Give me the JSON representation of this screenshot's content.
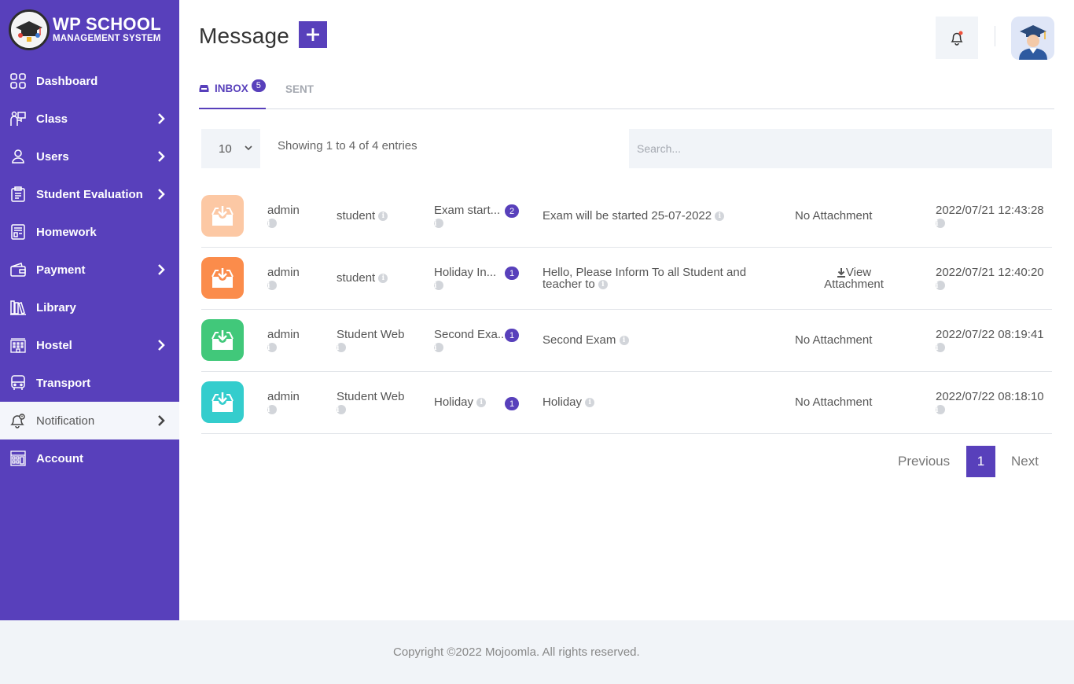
{
  "brand": {
    "title": "WP SCHOOL",
    "subtitle": "MANAGEMENT SYSTEM",
    "color": "#5840bb"
  },
  "sidebar": {
    "items": [
      {
        "label": "Dashboard",
        "icon": "dashboard-icon",
        "has_children": false
      },
      {
        "label": "Class",
        "icon": "class-icon",
        "has_children": true
      },
      {
        "label": "Users",
        "icon": "user-icon",
        "has_children": true
      },
      {
        "label": "Student Evaluation",
        "icon": "clipboard-icon",
        "has_children": true
      },
      {
        "label": "Homework",
        "icon": "homework-icon",
        "has_children": false
      },
      {
        "label": "Payment",
        "icon": "wallet-icon",
        "has_children": true
      },
      {
        "label": "Library",
        "icon": "books-icon",
        "has_children": false
      },
      {
        "label": "Hostel",
        "icon": "building-icon",
        "has_children": true
      },
      {
        "label": "Transport",
        "icon": "bus-icon",
        "has_children": false
      },
      {
        "label": "Notification",
        "icon": "notification-bell-icon",
        "has_children": true,
        "active": true
      },
      {
        "label": "Account",
        "icon": "account-icon",
        "has_children": false
      }
    ]
  },
  "header": {
    "title": "Message",
    "add_icon": "plus-icon",
    "bell_icon": "bell-icon",
    "avatar_icon": "graduate-avatar-icon"
  },
  "tabs": {
    "inbox_label": "INBOX",
    "inbox_count": "5",
    "sent_label": "SENT"
  },
  "table_controls": {
    "page_length": "10",
    "info": "Showing 1 to 4 of 4 entries",
    "search_placeholder": "Search..."
  },
  "messages": [
    {
      "icon_color": "#fcc8a4",
      "from": "admin",
      "to": "student",
      "subject": "Exam start...",
      "count": "2",
      "description": "Exam will be started 25-07-2022",
      "attachment": "No Attachment",
      "date": "2022/07/21 12:43:28"
    },
    {
      "icon_color": "#fb8c4b",
      "from": "admin",
      "to": "student",
      "subject": "Holiday In...",
      "count": "1",
      "description": "Hello, Please Inform To all Student and teacher to",
      "attachment": "View Attachment",
      "date": "2022/07/21 12:40:20"
    },
    {
      "icon_color": "#41c87a",
      "from": "admin",
      "to": "Student Web",
      "subject": "Second Exa...",
      "count": "1",
      "description": "Second Exam",
      "attachment": "No Attachment",
      "date": "2022/07/22 08:19:41"
    },
    {
      "icon_color": "#34cdcd",
      "from": "admin",
      "to": "Student Web",
      "subject": "Holiday",
      "count": "1",
      "description": "Holiday",
      "attachment": "No Attachment",
      "date": "2022/07/22 08:18:10"
    }
  ],
  "pagination": {
    "previous": "Previous",
    "current": "1",
    "next": "Next"
  },
  "footer": {
    "copyright": "Copyright ©2022 Mojoomla. All rights reserved."
  }
}
